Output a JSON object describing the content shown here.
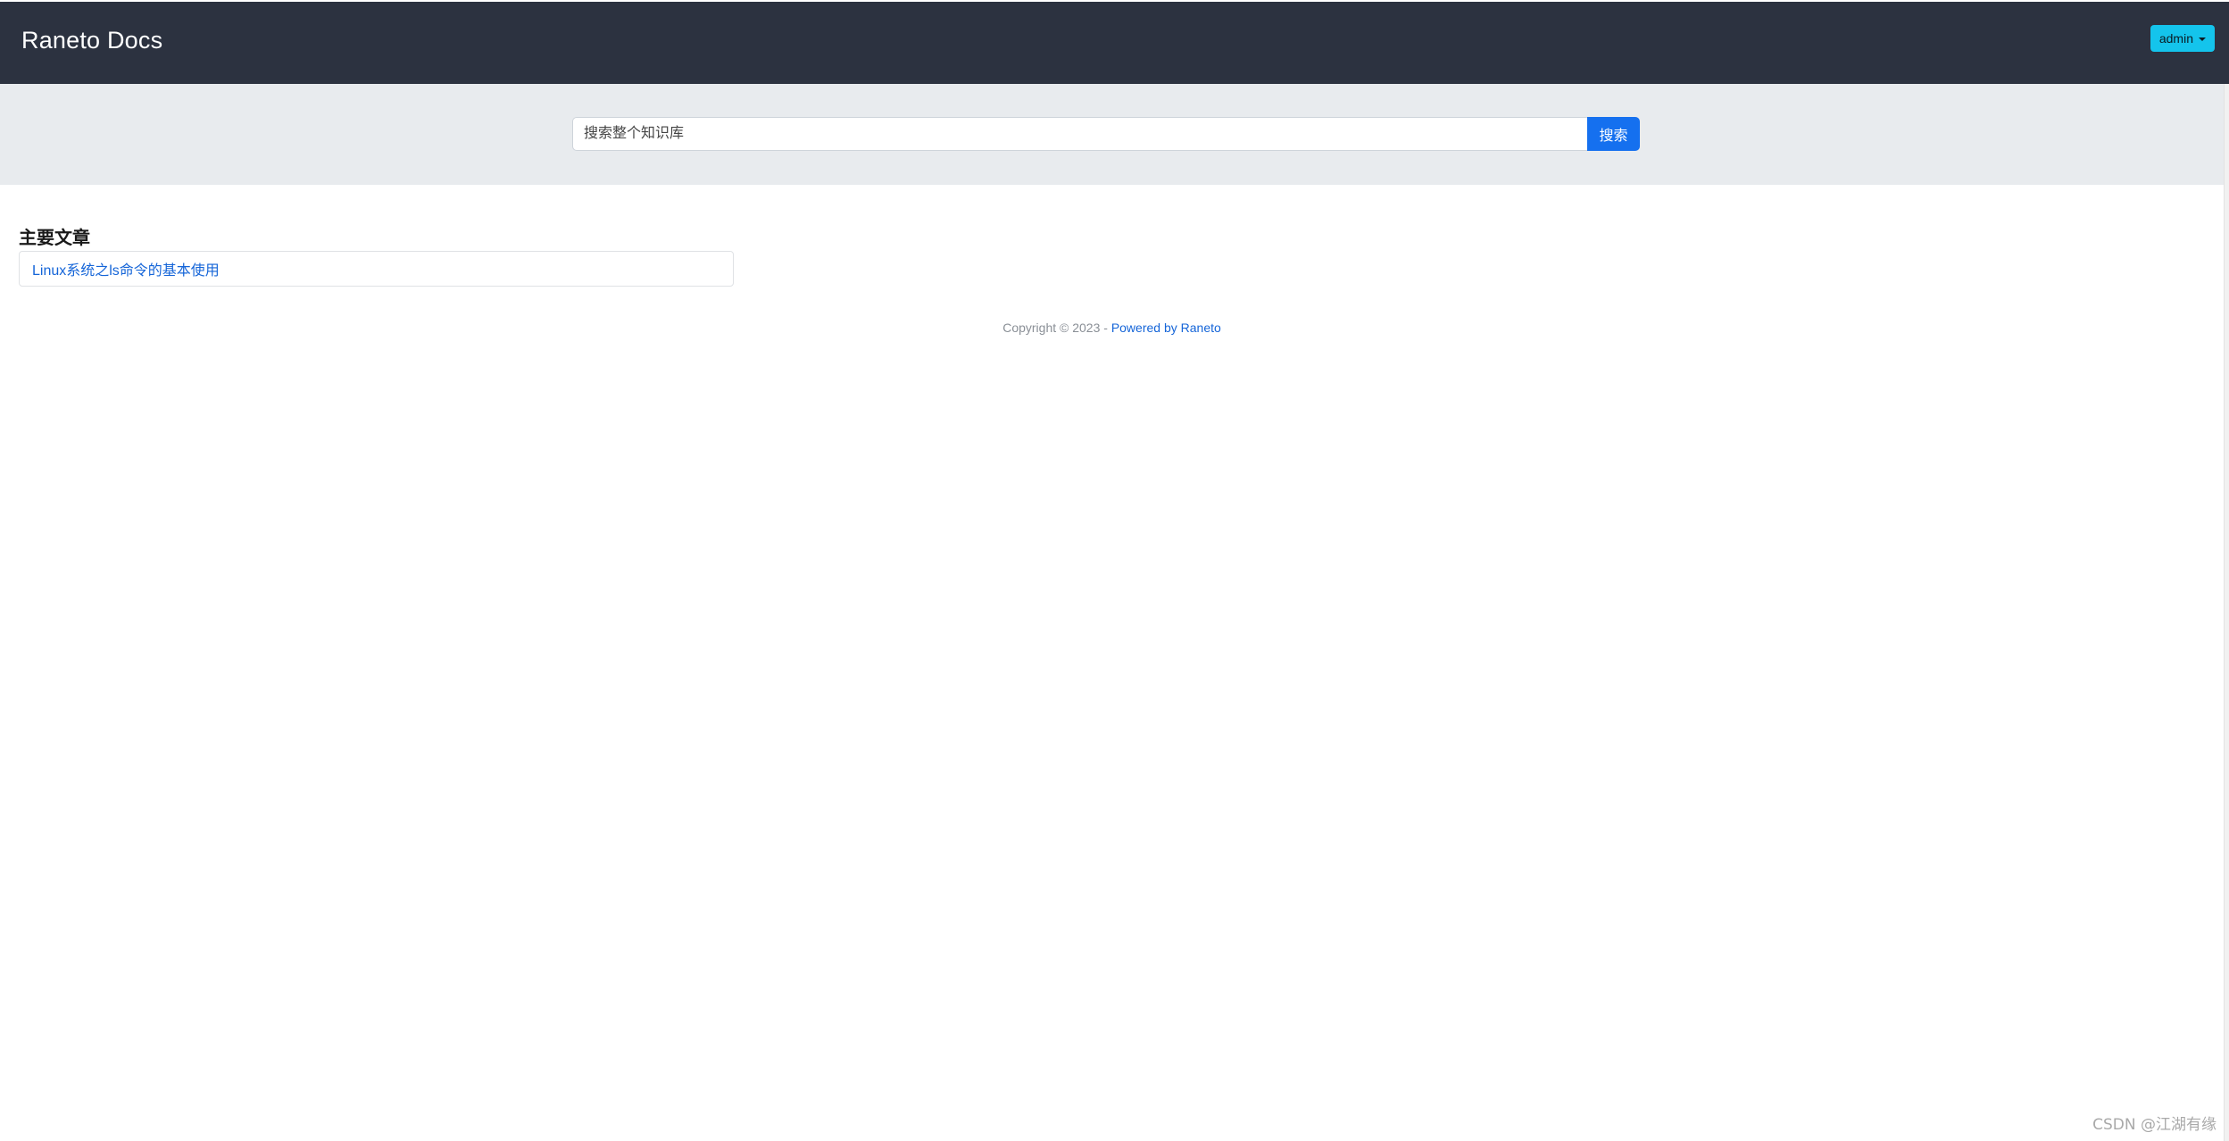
{
  "navbar": {
    "brand": "Raneto Docs",
    "user_menu_label": "admin"
  },
  "search": {
    "placeholder": "搜索整个知识库",
    "button_label": "搜索"
  },
  "main": {
    "section_title": "主要文章",
    "articles": [
      {
        "title": "Linux系统之ls命令的基本使用"
      }
    ]
  },
  "footer": {
    "copyright": "Copyright © 2023 - ",
    "powered_by": "Powered by Raneto"
  },
  "watermark": "CSDN @江湖有缘",
  "colors": {
    "navbar_bg": "#2c3240",
    "user_menu_bg": "#14c4ec",
    "search_band_bg": "#e8ebee",
    "primary": "#1570ef",
    "link": "#1565d8"
  },
  "icons": {
    "user_menu_caret": "caret-down-icon"
  }
}
